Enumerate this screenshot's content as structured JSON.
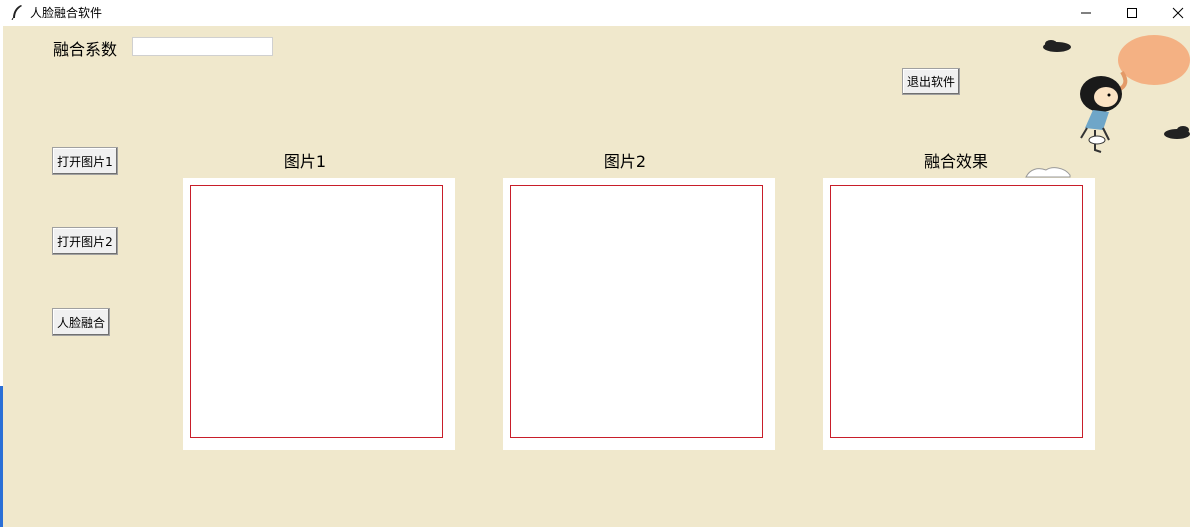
{
  "window": {
    "title": "人脸融合软件",
    "controls": [
      "minimize-icon",
      "maximize-icon",
      "close-icon"
    ]
  },
  "form": {
    "coef_label": "融合系数",
    "coef_value": ""
  },
  "buttons": {
    "exit": "退出软件",
    "open1": "打开图片1",
    "open2": "打开图片2",
    "fuse": "人脸融合"
  },
  "panels": {
    "img1_label": "图片1",
    "img2_label": "图片2",
    "result_label": "融合效果"
  },
  "colors": {
    "background": "#f0e8cc",
    "frame_border": "#c81e2a",
    "balloon": "#f4b183"
  },
  "decor": [
    "girl-balloon-illustration",
    "cloud-icon"
  ]
}
